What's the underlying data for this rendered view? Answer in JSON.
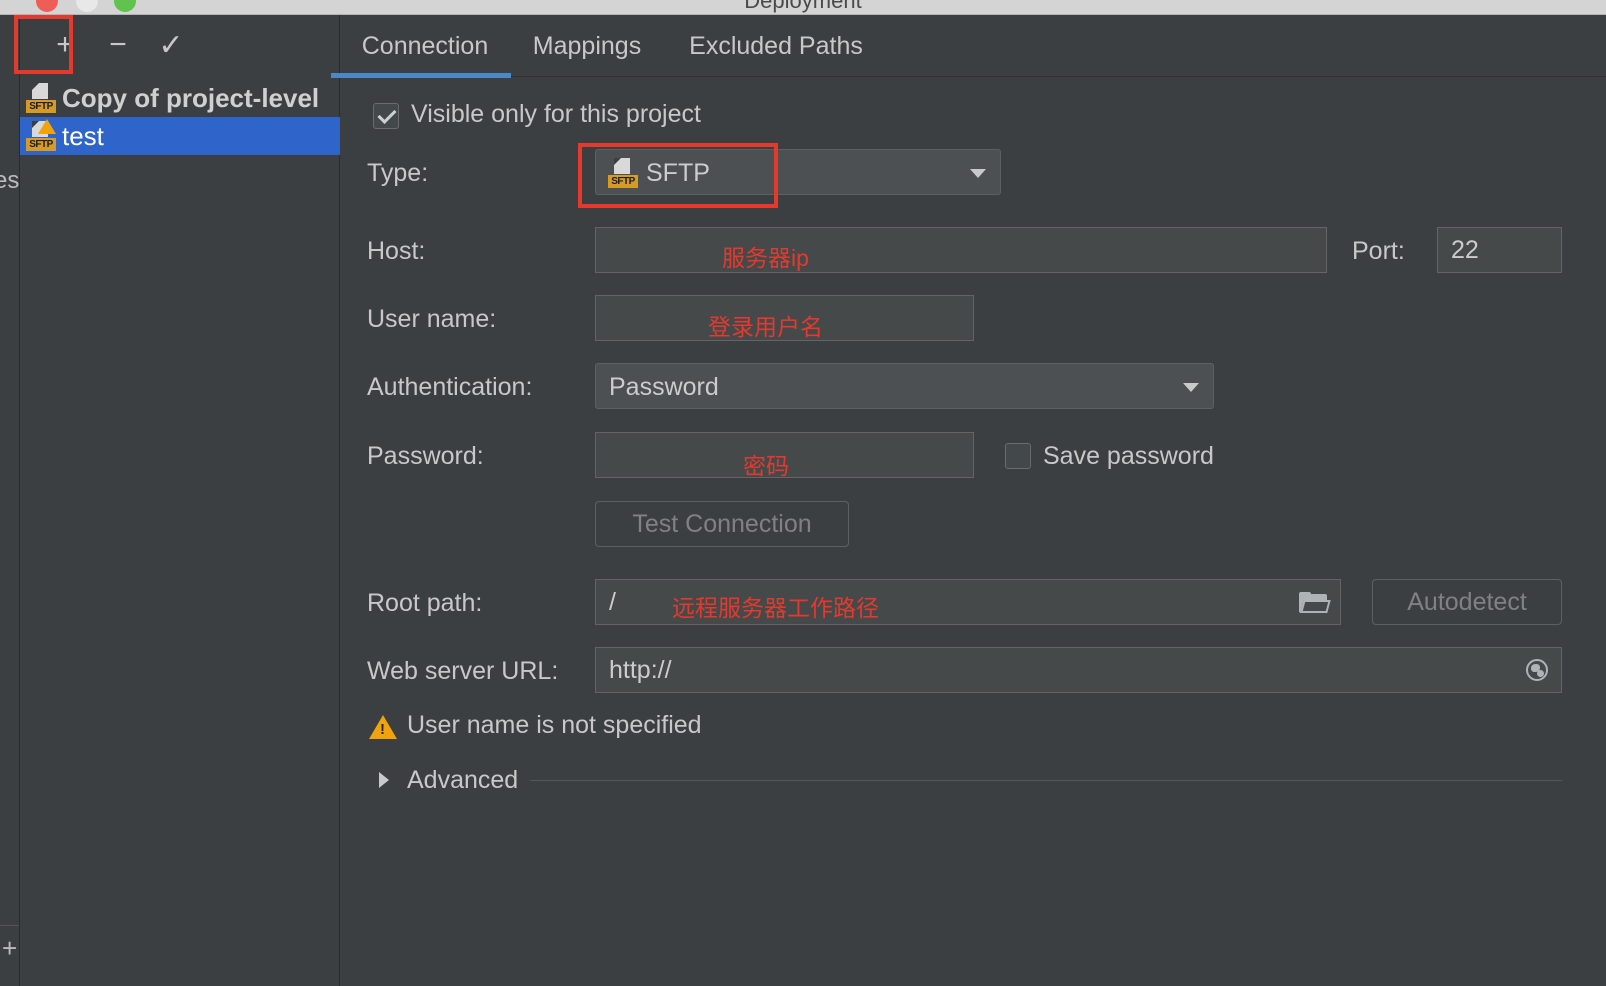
{
  "window": {
    "title": "Deployment"
  },
  "toolbar": {
    "add": "+",
    "remove": "−",
    "apply": "✓"
  },
  "servers": [
    {
      "label": "Copy of project-level",
      "icon": "sftp-server-icon",
      "bold": true
    },
    {
      "label": "test",
      "icon": "sftp-server-warning-icon",
      "selected": true
    }
  ],
  "parent": {
    "fragment": "es",
    "add": "+"
  },
  "tabs": [
    {
      "label": "Connection",
      "active": true
    },
    {
      "label": "Mappings"
    },
    {
      "label": "Excluded Paths"
    }
  ],
  "form": {
    "visible_only": {
      "label": "Visible only for this project",
      "checked": true
    },
    "type": {
      "label": "Type:",
      "value": "SFTP",
      "icon_tag": "SFTP"
    },
    "host": {
      "label": "Host:",
      "annotation": "服务器ip"
    },
    "port": {
      "label": "Port:",
      "value": "22"
    },
    "username": {
      "label": "User name:",
      "annotation": "登录用户名"
    },
    "auth": {
      "label": "Authentication:",
      "value": "Password"
    },
    "password": {
      "label": "Password:",
      "annotation": "密码"
    },
    "save_password": {
      "label": "Save password",
      "checked": false
    },
    "test_connection": "Test Connection",
    "root_path": {
      "label": "Root path:",
      "value": "/",
      "annotation": "远程服务器工作路径"
    },
    "autodetect": "Autodetect",
    "web_url": {
      "label": "Web server URL:",
      "value": "http://"
    },
    "warning": "User name is not specified",
    "advanced": "Advanced"
  },
  "colors": {
    "accent": "#2f65ca",
    "tab_underline": "#4a88c7",
    "annotation": "#e4392d",
    "warning": "#f0a30a",
    "sftp_tag": "#d69a27"
  }
}
